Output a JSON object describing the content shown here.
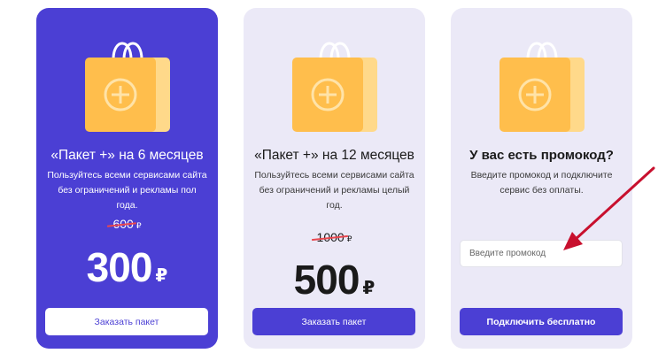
{
  "plans": [
    {
      "title": "«Пакет +» на 6 месяцев",
      "description": "Пользуйтесь всеми сервисами сайта без ограничений и рекламы пол года.",
      "old_price": "600",
      "old_currency": "₽",
      "new_price": "300",
      "new_currency": "₽",
      "button_label": "Заказать пакет"
    },
    {
      "title": "«Пакет +» на 12 месяцев",
      "description": "Пользуйтесь всеми сервисами сайта без ограничений и рекламы целый год.",
      "old_price": "1000",
      "old_currency": "₽",
      "new_price": "500",
      "new_currency": "₽",
      "button_label": "Заказать пакет"
    }
  ],
  "promo": {
    "title": "У вас есть промокод?",
    "description": "Введите промокод и подключите сервис без оплаты.",
    "input_value": "",
    "input_placeholder": "Введите промокод",
    "button_label": "Подключить бесплатно"
  },
  "icons": {
    "bag": "shopping-bag-plus-icon",
    "arrow": "red-arrow-annotation"
  },
  "colors": {
    "accent": "#4b3fd4",
    "card_bg": "#ebe9f7",
    "bag_front": "#ffbe4c",
    "bag_side": "#ffd98a",
    "strike": "#e8474f",
    "arrow": "#c8102e"
  }
}
